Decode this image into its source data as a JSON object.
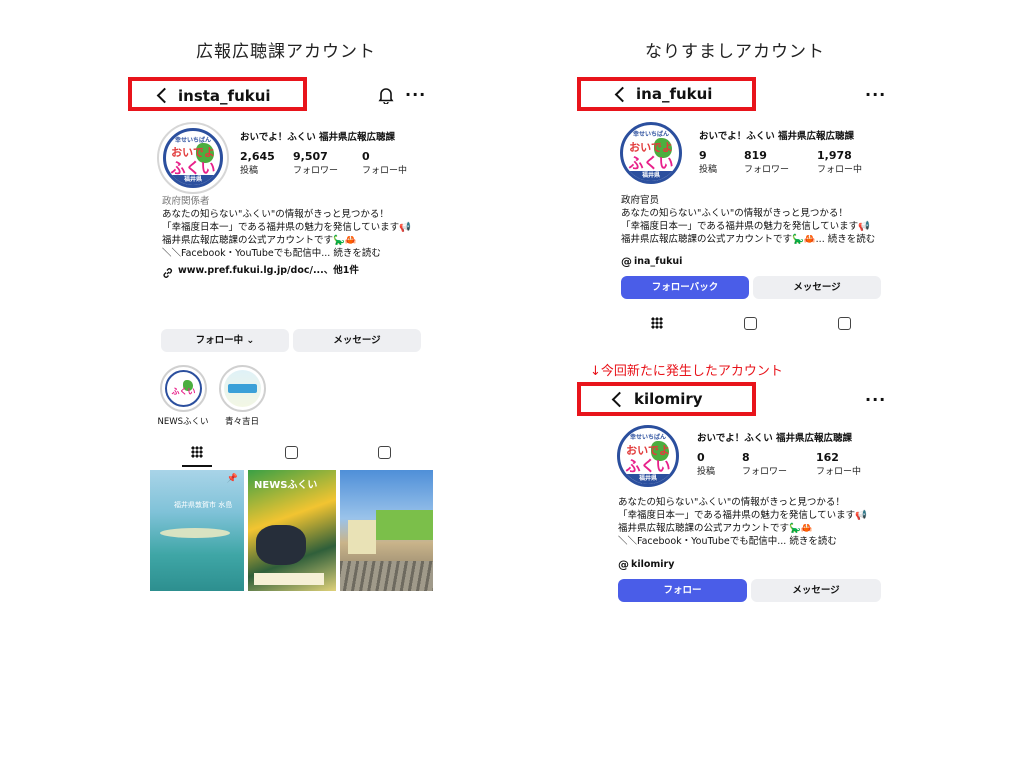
{
  "headings": {
    "official": "広報広聴課アカウント",
    "impersonation": "なりすましアカウント",
    "new_account_note": "↓今回新たに発生したアカウント"
  },
  "official_profile": {
    "username": "insta_fukui",
    "display_name": "おいでよ！ふくい 福井県広報広聴課",
    "stats": [
      {
        "value": "2,645",
        "label": "投稿"
      },
      {
        "value": "9,507",
        "label": "フォロワー"
      },
      {
        "value": "0",
        "label": "フォロー中"
      }
    ],
    "category": "政府関係者",
    "bio": [
      "あなたの知らない\"ふくい\"の情報がきっと見つかる！",
      "「幸福度日本一」である福井県の魅力を発信しています📢",
      "福井県広報広聴課の公式アカウントです🦕🦀",
      "＼＼Facebook・YouTubeでも配信中... 続きを読む"
    ],
    "link": "www.pref.fukui.lg.jp/doc/...、他1件",
    "buttons": {
      "following": "フォロー中",
      "message": "メッセージ"
    },
    "highlights": [
      {
        "label": "NEWSふくい"
      },
      {
        "label": "青々吉日"
      }
    ],
    "posts": [
      {
        "caption": "福井県敦賀市 水島"
      },
      {
        "caption": "NEWSふくい"
      },
      {
        "caption": ""
      }
    ]
  },
  "fake_profile_1": {
    "username": "ina_fukui",
    "display_name": "おいでよ！ふくい 福井県広報広聴課",
    "stats": [
      {
        "value": "9",
        "label": "投稿"
      },
      {
        "value": "819",
        "label": "フォロワー"
      },
      {
        "value": "1,978",
        "label": "フォロー中"
      }
    ],
    "category": "政府官员",
    "bio": [
      "あなたの知らない\"ふくい\"の情報がきっと見つかる！",
      "「幸福度日本一」である福井県の魅力を発信しています📢",
      "福井県広報広聴課の公式アカウントです🦕🦀... 続きを読む"
    ],
    "threads": "ina_fukui",
    "buttons": {
      "follow_back": "フォローバック",
      "message": "メッセージ"
    }
  },
  "fake_profile_2": {
    "username": "kilomiry",
    "display_name": "おいでよ！ふくい 福井県広報広聴課",
    "stats": [
      {
        "value": "0",
        "label": "投稿"
      },
      {
        "value": "8",
        "label": "フォロワー"
      },
      {
        "value": "162",
        "label": "フォロー中"
      }
    ],
    "bio": [
      "あなたの知らない\"ふくい\"の情報がきっと見つかる！",
      "「幸福度日本一」である福井県の魅力を発信しています📢",
      "福井県広報広聴課の公式アカウントです🦕🦀",
      "＼＼Facebook・YouTubeでも配信中... 続きを読む"
    ],
    "threads": "kilomiry",
    "buttons": {
      "follow": "フォロー",
      "message": "メッセージ"
    }
  },
  "logo": {
    "top": "幸せいちばん",
    "mid": "おいでよ",
    "bot": "ふくい",
    "band": "福井県"
  },
  "icons": [
    "back-icon",
    "bell-icon",
    "more-icon",
    "grid-icon",
    "reels-icon",
    "tagged-icon",
    "link-icon",
    "threads-icon",
    "pin-icon"
  ],
  "colors": {
    "highlight_red": "#e8141b",
    "follow_blue": "#4a5de8",
    "logo_blue": "#2b4f9e"
  }
}
